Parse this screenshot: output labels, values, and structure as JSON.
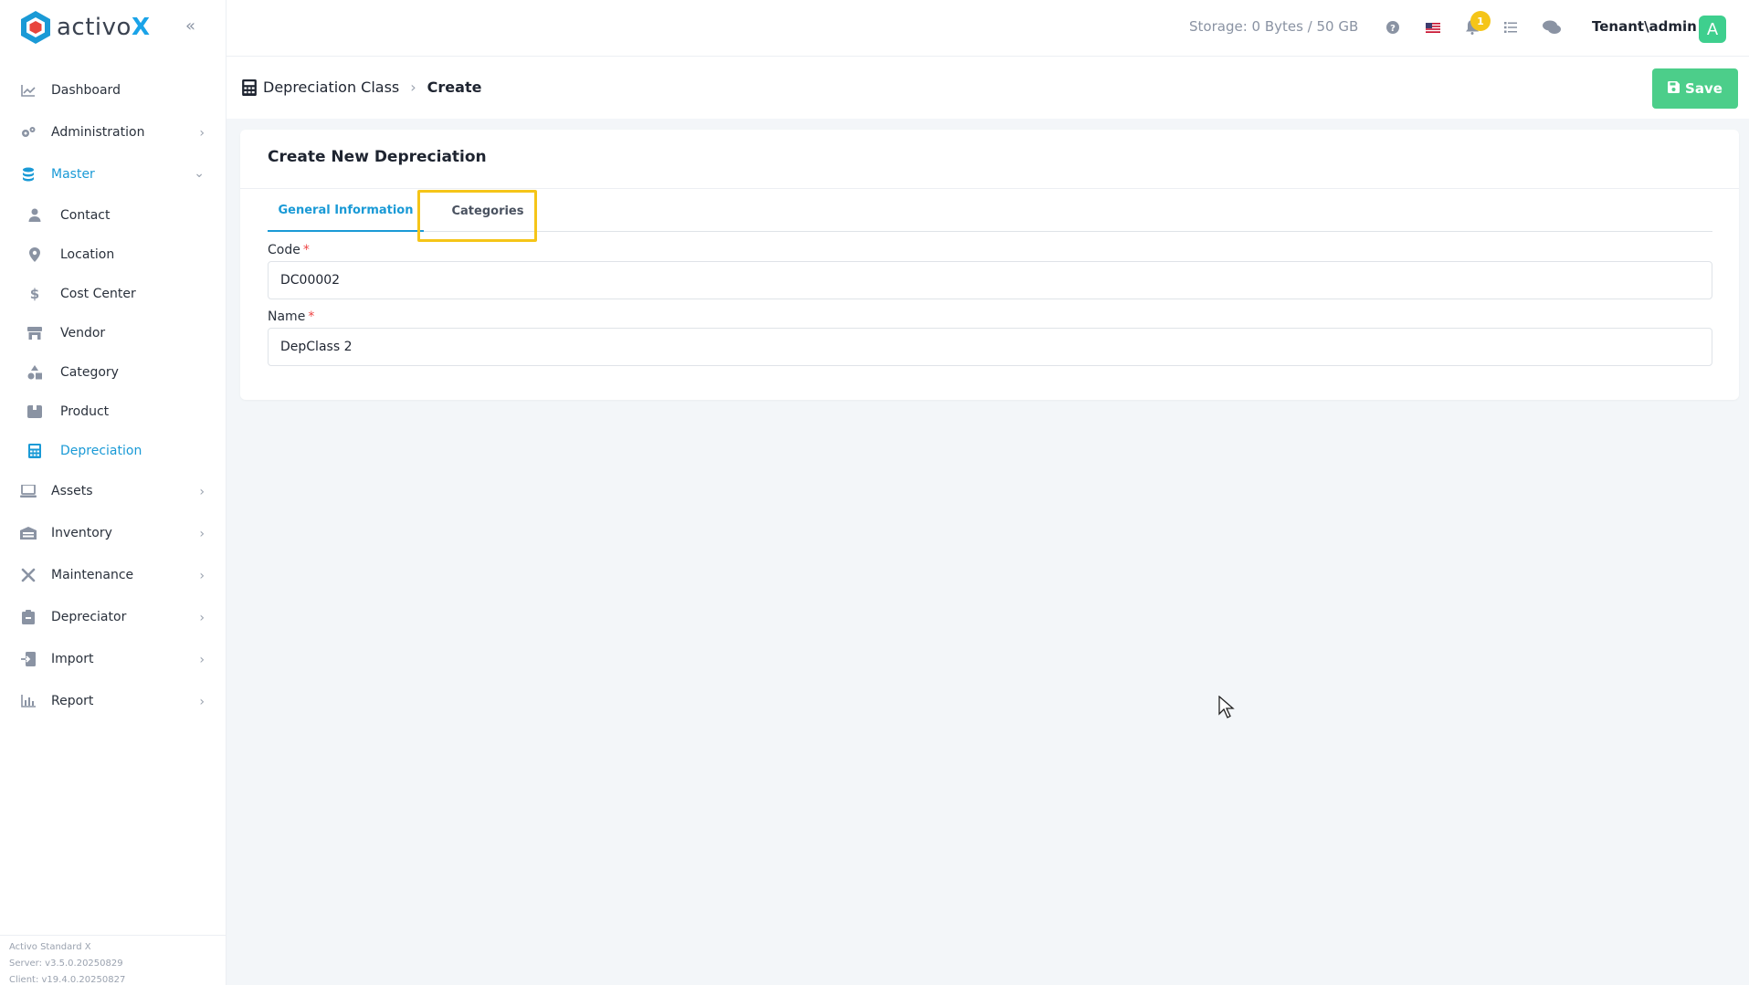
{
  "app": {
    "logo_text": "activo",
    "logo_x": "X"
  },
  "sidebar": {
    "items": [
      {
        "label": "Dashboard",
        "icon": "chart-line-icon"
      },
      {
        "label": "Administration",
        "icon": "gears-icon"
      },
      {
        "label": "Master",
        "icon": "database-icon"
      },
      {
        "label": "Assets",
        "icon": "laptop-icon"
      },
      {
        "label": "Inventory",
        "icon": "warehouse-icon"
      },
      {
        "label": "Maintenance",
        "icon": "tools-icon"
      },
      {
        "label": "Depreciator",
        "icon": "clipboard-icon"
      },
      {
        "label": "Import",
        "icon": "import-icon"
      },
      {
        "label": "Report",
        "icon": "bar-chart-icon"
      }
    ],
    "master_sub": [
      {
        "label": "Contact",
        "icon": "user-icon"
      },
      {
        "label": "Location",
        "icon": "map-pin-icon"
      },
      {
        "label": "Cost Center",
        "icon": "dollar-icon"
      },
      {
        "label": "Vendor",
        "icon": "store-icon"
      },
      {
        "label": "Category",
        "icon": "shapes-icon"
      },
      {
        "label": "Product",
        "icon": "box-icon"
      },
      {
        "label": "Depreciation",
        "icon": "calculator-icon"
      }
    ],
    "footer": {
      "line1": "Activo Standard X",
      "line2": "Server: v3.5.0.20250829",
      "line3": "Client: v19.4.0.20250827"
    }
  },
  "topbar": {
    "storage": "Storage: 0 Bytes / 50 GB",
    "notification_count": "1",
    "user": "Tenant\\admin",
    "avatar_letter": "A"
  },
  "header": {
    "breadcrumb_parent": "Depreciation Class",
    "breadcrumb_current": "Create",
    "save_label": "Save"
  },
  "form": {
    "title": "Create New Depreciation",
    "tabs": [
      "General Information",
      "Categories"
    ],
    "code_label": "Code",
    "code_value": "DC00002",
    "name_label": "Name",
    "name_value": "DepClass 2",
    "required_mark": "*"
  },
  "colors": {
    "accent": "#1a9ad6",
    "save": "#4cce8a",
    "highlight": "#f5c518"
  }
}
